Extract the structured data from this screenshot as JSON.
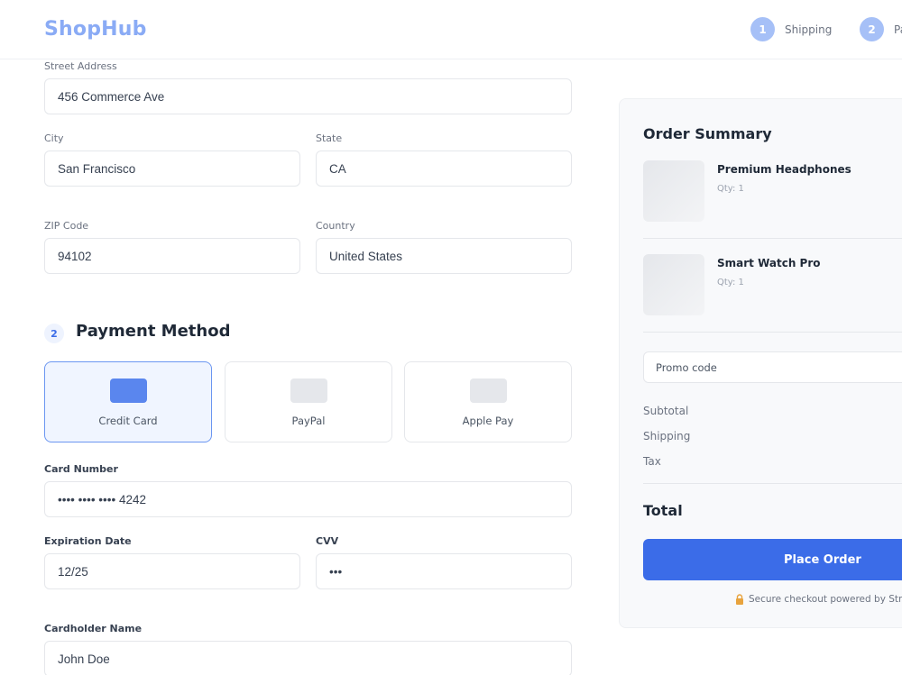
{
  "header": {
    "logo": "ShopHub",
    "steps": [
      {
        "number": "1",
        "label": "Shipping"
      },
      {
        "number": "2",
        "label": "Pa"
      }
    ]
  },
  "shipping": {
    "street": {
      "label": "Street Address",
      "value": "456 Commerce Ave"
    },
    "city": {
      "label": "City",
      "value": "San Francisco"
    },
    "state": {
      "label": "State",
      "value": "CA"
    },
    "zip": {
      "label": "ZIP Code",
      "value": "94102"
    },
    "country": {
      "label": "Country",
      "value": "United States"
    }
  },
  "payment": {
    "section_number": "2",
    "title": "Payment Method",
    "methods": [
      {
        "label": "Credit Card",
        "selected": true
      },
      {
        "label": "PayPal",
        "selected": false
      },
      {
        "label": "Apple Pay",
        "selected": false
      }
    ],
    "card_number": {
      "label": "Card Number",
      "value": "•••• •••• •••• 4242"
    },
    "expiration": {
      "label": "Expiration Date",
      "value": "12/25"
    },
    "cvv": {
      "label": "CVV",
      "value": "•••"
    },
    "cardholder": {
      "label": "Cardholder Name",
      "value": "John Doe"
    }
  },
  "summary": {
    "title": "Order Summary",
    "items": [
      {
        "name": "Premium Headphones",
        "qty": "Qty: 1"
      },
      {
        "name": "Smart Watch Pro",
        "qty": "Qty: 1"
      }
    ],
    "promo_placeholder": "Promo code",
    "lines": [
      "Subtotal",
      "Shipping",
      "Tax"
    ],
    "total_label": "Total",
    "place_order": "Place Order",
    "secure_text": "Secure checkout powered by Stripe"
  },
  "colors": {
    "accent": "#3b6ce8",
    "logo": "#8aabf5",
    "step_circle": "#a6c0f7",
    "selected_card_bg": "#f0f5ff"
  },
  "icons": {
    "secure": "lock-icon",
    "card": "credit-card-icon",
    "paypal": "paypal-icon",
    "applepay": "apple-pay-icon"
  }
}
